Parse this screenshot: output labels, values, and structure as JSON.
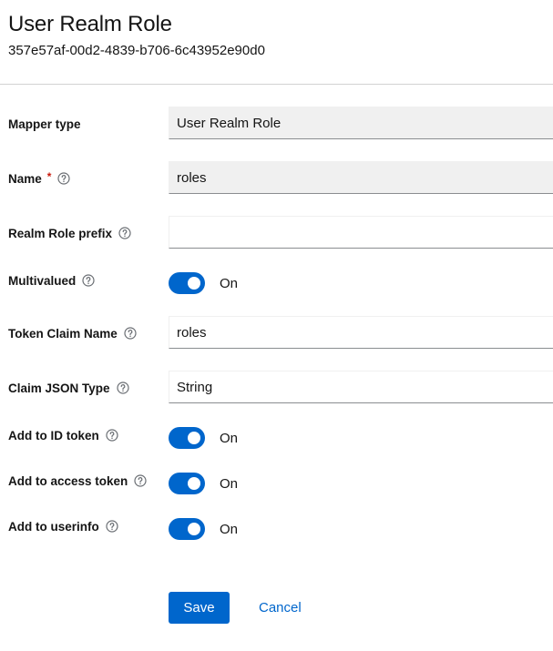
{
  "header": {
    "title": "User Realm Role",
    "subtitle": "357e57af-00d2-4839-b706-6c43952e90d0"
  },
  "form": {
    "mapper_type": {
      "label": "Mapper type",
      "value": "User Realm Role",
      "readonly": true
    },
    "name": {
      "label": "Name",
      "required_mark": "*",
      "value": "roles",
      "readonly": true,
      "help_icon": "help-circle-icon"
    },
    "realm_role_prefix": {
      "label": "Realm Role prefix",
      "value": "",
      "placeholder": "",
      "help_icon": "help-circle-icon"
    },
    "multivalued": {
      "label": "Multivalued",
      "state": "On",
      "checked": true,
      "help_icon": "help-circle-icon"
    },
    "token_claim_name": {
      "label": "Token Claim Name",
      "value": "roles",
      "help_icon": "help-circle-icon"
    },
    "claim_json_type": {
      "label": "Claim JSON Type",
      "value": "String",
      "help_icon": "help-circle-icon"
    },
    "add_to_id_token": {
      "label": "Add to ID token",
      "state": "On",
      "checked": true,
      "help_icon": "help-circle-icon"
    },
    "add_to_access_token": {
      "label": "Add to access token",
      "state": "On",
      "checked": true,
      "help_icon": "help-circle-icon"
    },
    "add_to_userinfo": {
      "label": "Add to userinfo",
      "state": "On",
      "checked": true,
      "help_icon": "help-circle-icon"
    }
  },
  "actions": {
    "save_label": "Save",
    "cancel_label": "Cancel"
  },
  "colors": {
    "primary": "#0066cc",
    "required": "#c9190b",
    "readonly_bg": "#f0f0f0",
    "text": "#151515"
  }
}
